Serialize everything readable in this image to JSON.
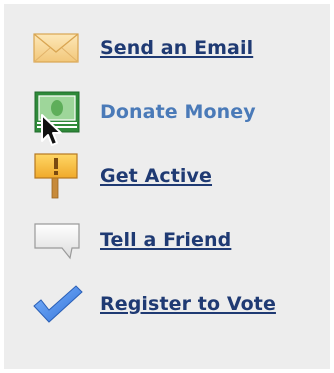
{
  "actions": {
    "items": [
      {
        "label": "Send an Email",
        "icon": "envelope-icon",
        "state": "link"
      },
      {
        "label": "Donate Money",
        "icon": "money-icon",
        "state": "hover"
      },
      {
        "label": "Get Active",
        "icon": "signpost-icon",
        "state": "link"
      },
      {
        "label": "Tell a Friend",
        "icon": "speech-bubble-icon",
        "state": "link"
      },
      {
        "label": "Register to Vote",
        "icon": "checkmark-icon",
        "state": "link"
      }
    ]
  },
  "colors": {
    "panel_bg": "#ededed",
    "link": "#1f3a73",
    "hover_link": "#4a7ab8"
  },
  "cursor": {
    "icon": "arrow-cursor-icon"
  }
}
